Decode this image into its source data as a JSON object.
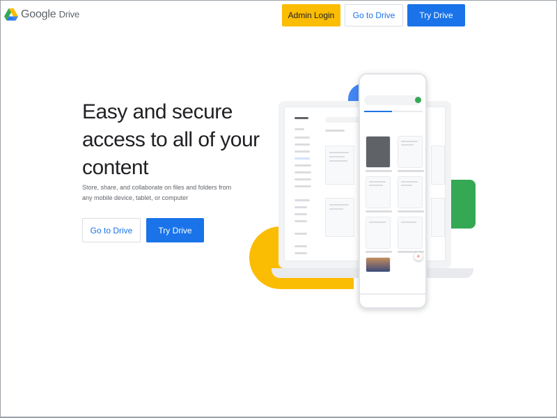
{
  "header": {
    "logo_text": "Google",
    "product_text": "Drive",
    "admin_login_label": "Admin Login",
    "go_to_drive_label": "Go to Drive",
    "try_drive_label": "Try Drive"
  },
  "hero": {
    "headline": "Easy and secure access to all of your content",
    "subtext": "Store, share, and collaborate on files and folders from any mobile device, tablet, or computer",
    "go_to_drive_label": "Go to Drive",
    "try_drive_label": "Try Drive"
  },
  "colors": {
    "brand_blue": "#1a73e8",
    "brand_yellow": "#fbbc04",
    "brand_green": "#34a853",
    "brand_red": "#ea4335"
  }
}
